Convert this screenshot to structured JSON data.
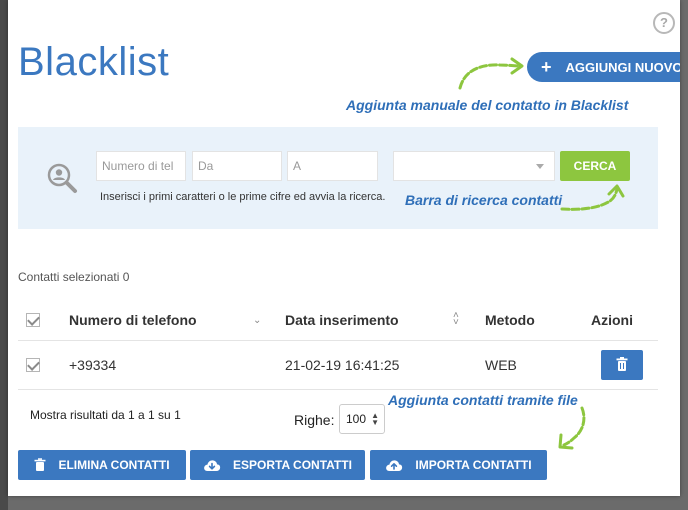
{
  "title": "Blacklist",
  "add_button": {
    "label": "AGGIUNGI NUOVO"
  },
  "annotations": {
    "add_manual": "Aggiunta manuale del contatto in Blacklist",
    "search_bar": "Barra di ricerca contatti",
    "add_file": "Aggiunta contatti tramite file"
  },
  "search": {
    "phone_placeholder": "Numero di tel",
    "from_placeholder": "Da",
    "to_placeholder": "A",
    "select_value": "",
    "button_label": "CERCA",
    "hint": "Inserisci i primi caratteri o le prime cifre ed avvia la ricerca."
  },
  "selected_count": "Contatti selezionati 0",
  "table": {
    "columns": [
      "Numero di telefono",
      "Data inserimento",
      "Metodo",
      "Azioni"
    ],
    "rows": [
      {
        "phone": "+39334",
        "date": "21-02-19 16:41:25",
        "method": "WEB",
        "checked": true
      }
    ]
  },
  "footer": {
    "results": "Mostra risultati da 1 a 1 su 1",
    "rows_label": "Righe:",
    "rows_value": "100"
  },
  "buttons": {
    "delete": "ELIMINA CONTATTI",
    "export": "ESPORTA CONTATTI",
    "import": "IMPORTA CONTATTI"
  },
  "colors": {
    "primary": "#3b78c0",
    "search_button": "#8dc63f",
    "arrow": "#8dc63f",
    "annotation": "#2f6fb8",
    "search_bg": "#e9f2fa"
  },
  "icons": [
    "help-icon",
    "plus-icon",
    "search-person-icon",
    "trash-icon",
    "cloud-download-icon",
    "cloud-upload-icon",
    "chevron-down-icon",
    "sort-icon",
    "checkbox-icon"
  ]
}
